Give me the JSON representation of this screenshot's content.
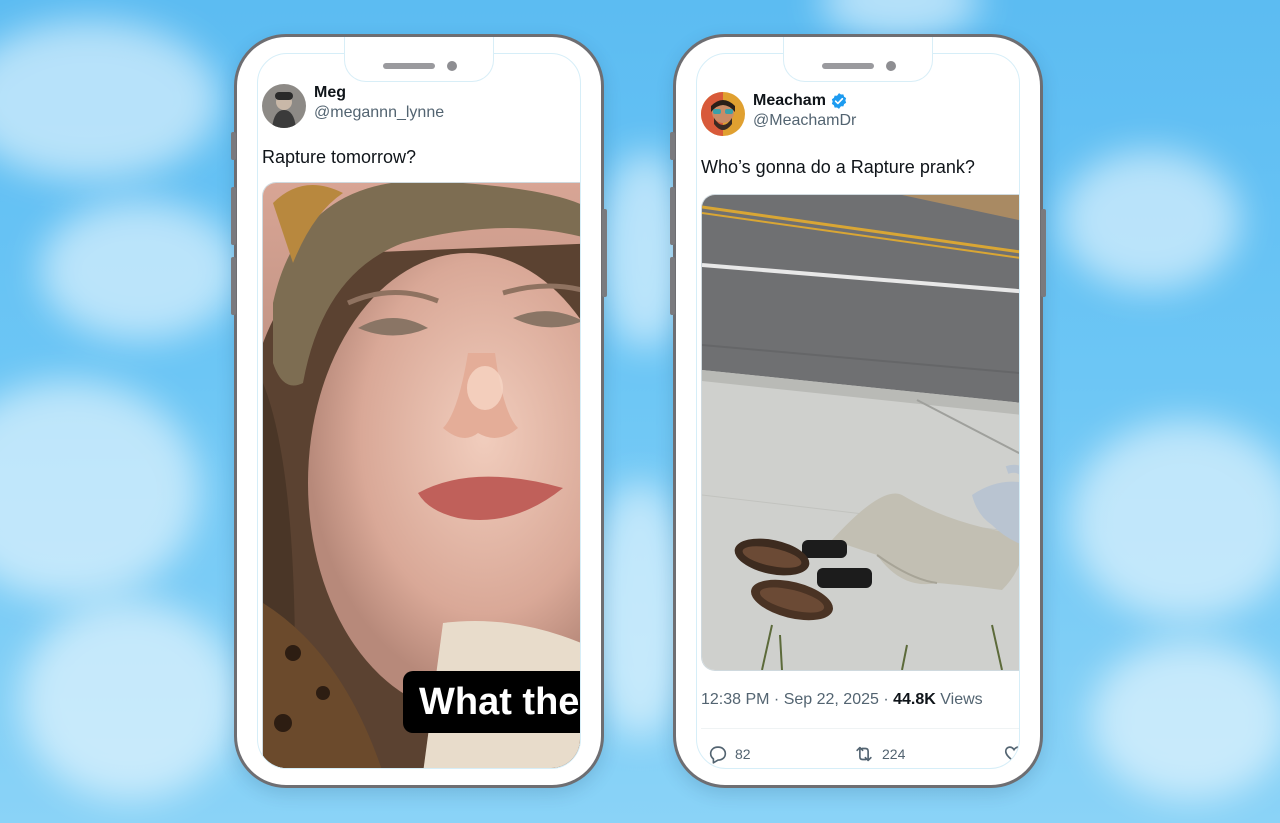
{
  "tweets": [
    {
      "display_name": "Meg",
      "handle": "@megannn_lynne",
      "text": "Rapture tomorrow?",
      "media_caption": "What the",
      "verified": false,
      "avatar_icon": "user-photo-avatar"
    },
    {
      "display_name": "Meacham",
      "handle": "@MeachamDr",
      "text": "Who’s gonna do a Rapture prank?",
      "verified": true,
      "avatar_icon": "user-photo-avatar",
      "time": "12:38 PM · Sep 22, 2025 · ",
      "views_count": "44.8K",
      "views_label": " Views",
      "replies": "82",
      "retweets": "224"
    }
  ],
  "colors": {
    "sky": "#5cbcf2",
    "verified": "#1d9bf0",
    "text_primary": "#0f1419",
    "text_secondary": "#536471"
  },
  "icons": [
    "reply-icon",
    "retweet-icon",
    "like-icon",
    "verified-badge-icon"
  ]
}
